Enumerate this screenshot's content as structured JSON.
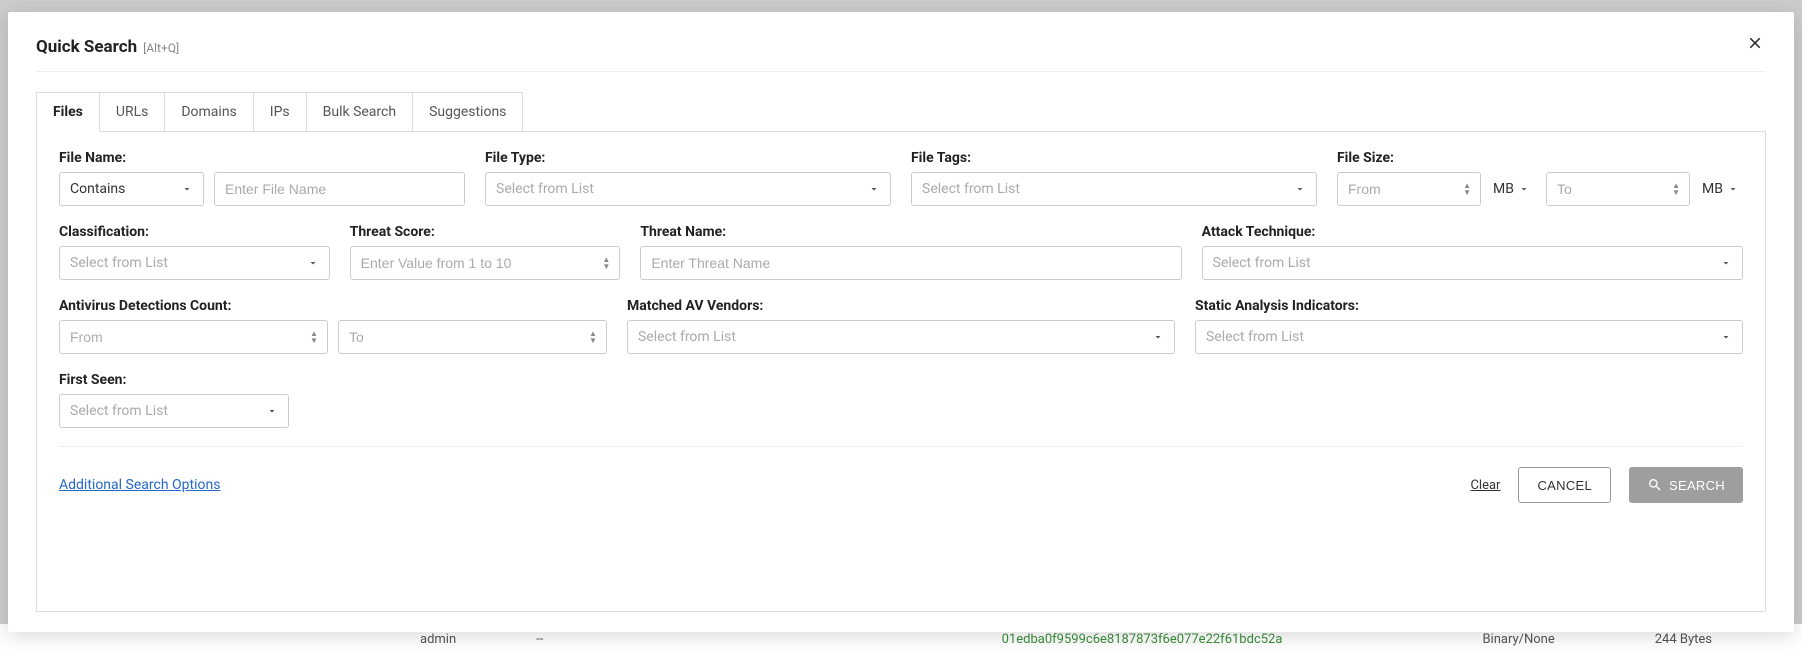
{
  "header": {
    "title": "Quick Search",
    "shortcut": "[Alt+Q]"
  },
  "tabs": {
    "files": "Files",
    "urls": "URLs",
    "domains": "Domains",
    "ips": "IPs",
    "bulk": "Bulk Search",
    "suggestions": "Suggestions"
  },
  "labels": {
    "file_name": "File Name:",
    "file_type": "File Type:",
    "file_tags": "File Tags:",
    "file_size": "File Size:",
    "classification": "Classification:",
    "threat_score": "Threat Score:",
    "threat_name": "Threat Name:",
    "attack_technique": "Attack Technique:",
    "av_count": "Antivirus Detections Count:",
    "matched_av": "Matched AV Vendors:",
    "static_analysis": "Static Analysis Indicators:",
    "first_seen": "First Seen:"
  },
  "placeholders": {
    "contains": "Contains",
    "enter_file_name": "Enter File Name",
    "select_list": "Select from List",
    "from": "From",
    "to": "To",
    "enter_1_10": "Enter Value from 1 to 10",
    "enter_threat_name": "Enter Threat Name"
  },
  "units": {
    "mb": "MB"
  },
  "footer": {
    "additional": "Additional Search Options",
    "clear": "Clear",
    "cancel": "CANCEL",
    "search": "SEARCH"
  },
  "bg": {
    "user": "admin",
    "dash": "--",
    "hash": "01edba0f9599c6e8187873f6e077e22f61bdc52a",
    "type": "Binary/None",
    "size": "244 Bytes"
  }
}
